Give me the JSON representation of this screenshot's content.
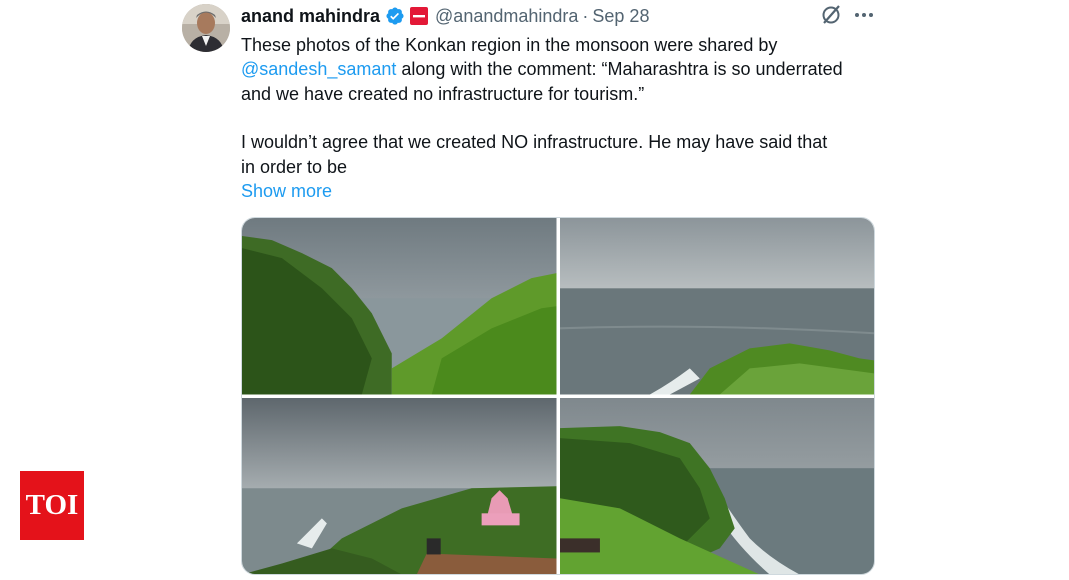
{
  "tweet": {
    "author_name": "anand mahindra",
    "handle": "@anandmahindra",
    "separator": "·",
    "date": "Sep 28",
    "text": {
      "line1": "These photos of the Konkan region in the monsoon were shared by",
      "mention": "@sandesh_samant",
      "line2_rest": " along with the comment: “Maharashtra is so underrated",
      "line3": "and we have created no infrastructure for tourism.”",
      "para2_line1": "I wouldn’t agree that we created NO infrastructure. He may have said that",
      "para2_line2": "in order to be"
    },
    "show_more": "Show more",
    "photos": [
      {
        "name": "photo-1",
        "description": "green cliff over sea"
      },
      {
        "name": "photo-2",
        "description": "sea horizon with headland"
      },
      {
        "name": "photo-3",
        "description": "coast with pink temple"
      },
      {
        "name": "photo-4",
        "description": "cliff edge with waves"
      }
    ]
  },
  "watermark": {
    "text": "TOI",
    "color": "#e4121a"
  },
  "colors": {
    "link": "#1d9bf0",
    "secondary_text": "#536471",
    "primary_text": "#0f1419"
  },
  "icons": [
    "verified-badge-icon",
    "affiliate-badge-icon",
    "grok-icon",
    "more-options-icon"
  ]
}
